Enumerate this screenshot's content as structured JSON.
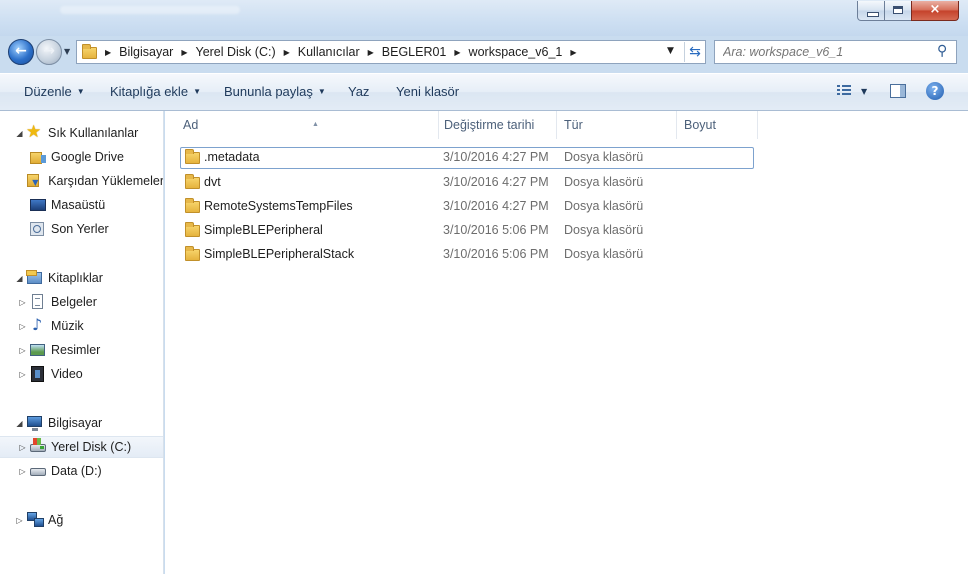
{
  "window": {
    "controls": {
      "minimize": "minimize",
      "maximize": "maximize",
      "close": "×"
    }
  },
  "address": {
    "crumbs": [
      "Bilgisayar",
      "Yerel Disk (C:)",
      "Kullanıcılar",
      "BEGLER01",
      "workspace_v6_1"
    ]
  },
  "search": {
    "placeholder": "Ara: workspace_v6_1"
  },
  "toolbar": {
    "organize": "Düzenle",
    "include_in_library": "Kitaplığa ekle",
    "share_with": "Bununla paylaş",
    "burn": "Yaz",
    "new_folder": "Yeni klasör"
  },
  "navigation": {
    "favorites": {
      "label": "Sık Kullanılanlar",
      "items": [
        "Google Drive",
        "Karşıdan Yüklemeler",
        "Masaüstü",
        "Son Yerler"
      ]
    },
    "libraries": {
      "label": "Kitaplıklar",
      "items": [
        "Belgeler",
        "Müzik",
        "Resimler",
        "Video"
      ]
    },
    "computer": {
      "label": "Bilgisayar",
      "items": [
        "Yerel Disk (C:)",
        "Data (D:)"
      ]
    },
    "network": {
      "label": "Ağ"
    }
  },
  "columns": {
    "name": "Ad",
    "date": "Değiştirme tarihi",
    "type": "Tür",
    "size": "Boyut"
  },
  "files": [
    {
      "name": ".metadata",
      "date": "3/10/2016 4:27 PM",
      "type": "Dosya klasörü",
      "size": ""
    },
    {
      "name": "dvt",
      "date": "3/10/2016 4:27 PM",
      "type": "Dosya klasörü",
      "size": ""
    },
    {
      "name": "RemoteSystemsTempFiles",
      "date": "3/10/2016 4:27 PM",
      "type": "Dosya klasörü",
      "size": ""
    },
    {
      "name": "SimpleBLEPeripheral",
      "date": "3/10/2016 5:06 PM",
      "type": "Dosya klasörü",
      "size": ""
    },
    {
      "name": "SimpleBLEPeripheralStack",
      "date": "3/10/2016 5:06 PM",
      "type": "Dosya klasörü",
      "size": ""
    }
  ]
}
